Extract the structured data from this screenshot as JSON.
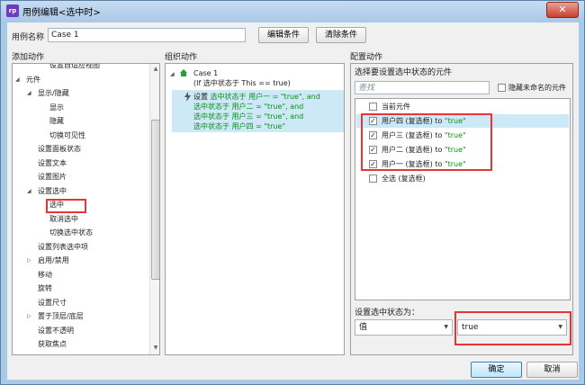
{
  "window": {
    "title": "用例编辑<选中时>",
    "app_icon": "rp"
  },
  "case_name": {
    "label": "用例名称",
    "value": "Case 1",
    "edit_btn": "编辑条件",
    "clear_btn": "清除条件"
  },
  "add_actions": {
    "header": "添加动作",
    "items": [
      {
        "label": "设置自适应视图",
        "level": 2,
        "toggle": ""
      },
      {
        "label": "元件",
        "level": 0,
        "toggle": "◢"
      },
      {
        "label": "显示/隐藏",
        "level": 1,
        "toggle": "◢"
      },
      {
        "label": "显示",
        "level": 2,
        "toggle": ""
      },
      {
        "label": "隐藏",
        "level": 2,
        "toggle": ""
      },
      {
        "label": "切换可见性",
        "level": 2,
        "toggle": ""
      },
      {
        "label": "设置面板状态",
        "level": 1,
        "toggle": ""
      },
      {
        "label": "设置文本",
        "level": 1,
        "toggle": ""
      },
      {
        "label": "设置图片",
        "level": 1,
        "toggle": ""
      },
      {
        "label": "设置选中",
        "level": 1,
        "toggle": "◢"
      },
      {
        "label": "选中",
        "level": 2,
        "toggle": ""
      },
      {
        "label": "取消选中",
        "level": 2,
        "toggle": ""
      },
      {
        "label": "切换选中状态",
        "level": 2,
        "toggle": ""
      },
      {
        "label": "设置列表选中项",
        "level": 1,
        "toggle": ""
      },
      {
        "label": "启用/禁用",
        "level": 1,
        "toggle": "▷"
      },
      {
        "label": "移动",
        "level": 1,
        "toggle": ""
      },
      {
        "label": "旋转",
        "level": 1,
        "toggle": ""
      },
      {
        "label": "设置尺寸",
        "level": 1,
        "toggle": ""
      },
      {
        "label": "置于顶层/底层",
        "level": 1,
        "toggle": "▷"
      },
      {
        "label": "设置不透明",
        "level": 1,
        "toggle": ""
      },
      {
        "label": "获取焦点",
        "level": 1,
        "toggle": ""
      }
    ]
  },
  "organize": {
    "header": "组织动作",
    "case_title": "Case 1",
    "case_condition": "(If 选中状态于 This == true)",
    "action_prefix": "设置",
    "action_lines": [
      "选中状态于 用户一 = \"true\", and",
      "选中状态于 用户二 = \"true\", and",
      "选中状态于 用户三 = \"true\", and",
      "选中状态于 用户四 = \"true\""
    ]
  },
  "configure": {
    "header": "配置动作",
    "subheader": "选择要设置选中状态的元件",
    "search_placeholder": "查找",
    "hide_unnamed_label": "隐藏未命名的元件",
    "widgets": [
      {
        "name": "当前元件",
        "suffix": "",
        "checked": false
      },
      {
        "name": "用户四 (复选框) to ",
        "suffix": "\"true\"",
        "checked": true
      },
      {
        "name": "用户三 (复选框) to ",
        "suffix": "\"true\"",
        "checked": true
      },
      {
        "name": "用户二 (复选框) to ",
        "suffix": "\"true\"",
        "checked": true
      },
      {
        "name": "用户一 (复选框) to ",
        "suffix": "\"true\"",
        "checked": true
      },
      {
        "name": "全选 (复选框)",
        "suffix": "",
        "checked": false
      }
    ],
    "set_state_label": "设置选中状态为：",
    "value_type": "值",
    "value": "true"
  },
  "footer": {
    "ok": "确定",
    "cancel": "取消"
  },
  "colors": {
    "accent_red": "#e53535",
    "selected_row": "#cde8f6",
    "green_text": "#0a8f16"
  }
}
